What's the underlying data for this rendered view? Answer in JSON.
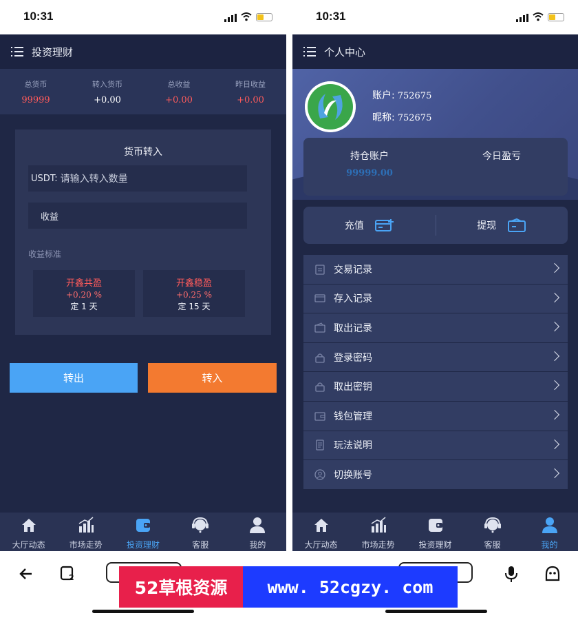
{
  "status": {
    "time": "10:31"
  },
  "left": {
    "nav_title": "投资理财",
    "stats": [
      {
        "label": "总货币",
        "value": "99999",
        "color": "#ff5b5b"
      },
      {
        "label": "转入货币",
        "value": "+0.00",
        "color": "#ffffff"
      },
      {
        "label": "总收益",
        "value": "+0.00",
        "color": "#ff5b5b"
      },
      {
        "label": "昨日收益",
        "value": "+0.00",
        "color": "#ff5b5b"
      }
    ],
    "card_title": "货币转入",
    "usdt_label": "USDT:",
    "usdt_placeholder": "请输入转入数量",
    "income_label": "收益",
    "standard_label": "收益标准",
    "plans": [
      {
        "name": "开鑫共盈",
        "rate": "+0.20 %",
        "term": "定 1 天"
      },
      {
        "name": "开鑫稳盈",
        "rate": "+0.25 %",
        "term": "定 15 天"
      }
    ],
    "btn_out": "转出",
    "btn_in": "转入",
    "active_tab": 2
  },
  "right": {
    "nav_title": "个人中心",
    "account_label": "账户:",
    "account_value": "752675",
    "nickname_label": "昵称:",
    "nickname_value": "752675",
    "holding_label": "持仓账户",
    "holding_value": "99999.00",
    "today_label": "今日盈亏",
    "recharge": "充值",
    "withdraw": "提现",
    "menu": [
      "交易记录",
      "存入记录",
      "取出记录",
      "登录密码",
      "取出密钥",
      "钱包管理",
      "玩法说明",
      "切换账号"
    ],
    "active_tab": 4
  },
  "tabs": [
    "大厅动态",
    "市场走势",
    "投资理财",
    "客服",
    "我的"
  ],
  "tab_icons": [
    "home-icon",
    "chart-icon",
    "wallet-icon",
    "support-icon",
    "user-icon"
  ],
  "banner": {
    "left": "52草根资源",
    "right": "www. 52cgzy. com"
  },
  "colors": {
    "accent": "#4aa4f5",
    "orange": "#f37a30",
    "red": "#ff5b5b",
    "bg": "#1f2745"
  }
}
